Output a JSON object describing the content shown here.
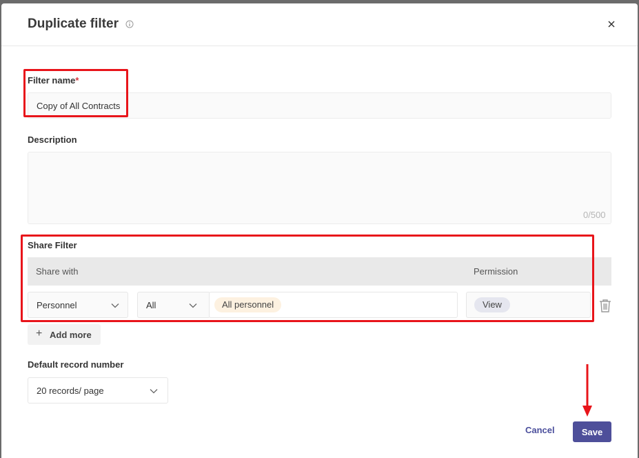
{
  "dialog": {
    "title": "Duplicate filter",
    "close_icon": "close-icon",
    "info_icon": "info-icon"
  },
  "filter_name": {
    "label": "Filter name",
    "required_mark": "*",
    "value": "Copy of All Contracts"
  },
  "description": {
    "label": "Description",
    "value": "",
    "counter": "0/500"
  },
  "share_filter": {
    "label": "Share Filter",
    "columns": [
      "Share with",
      "Permission"
    ],
    "rows": [
      {
        "type": "Personnel",
        "scope": "All",
        "tags": [
          "All personnel"
        ],
        "permission": "View"
      }
    ],
    "add_more_label": "Add more"
  },
  "default_record": {
    "label": "Default record number",
    "value": "20 records/ page"
  },
  "footer": {
    "cancel_label": "Cancel",
    "save_label": "Save"
  },
  "colors": {
    "primary": "#4e4f9a",
    "annotation": "#e8141a",
    "tag_personnel": "#fdf1e0",
    "tag_permission": "#e5e6ef"
  }
}
